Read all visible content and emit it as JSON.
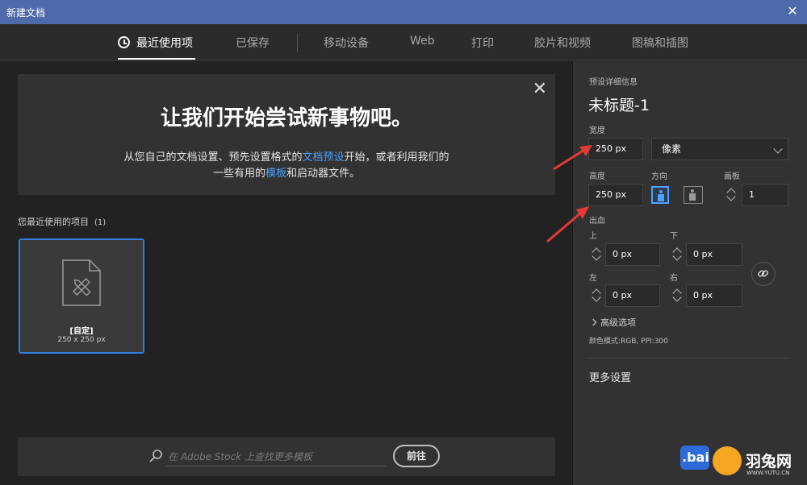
{
  "window": {
    "title": "新建文档",
    "close_label": "✕"
  },
  "tabs": [
    {
      "label": "最近使用项",
      "active": true
    },
    {
      "label": "已保存"
    },
    {
      "label": "移动设备"
    },
    {
      "label": "Web"
    },
    {
      "label": "打印"
    },
    {
      "label": "胶片和视频"
    },
    {
      "label": "图稿和插图"
    }
  ],
  "banner": {
    "close_label": "✕",
    "headline": "让我们开始尝试新事物吧。",
    "line1_before": "从您自己的文档设置、预先设置格式的",
    "line1_link": "文档预设",
    "line1_after": "开始，或者利用我们的",
    "line2_before": "一些有用的",
    "line2_link": "模板",
    "line2_after": "和启动器文件。"
  },
  "recent": {
    "label": "您最近使用的项目",
    "count": "(1)",
    "items": [
      {
        "name": "[自定]",
        "size": "250 x 250 px"
      }
    ]
  },
  "search": {
    "placeholder": "在 Adobe Stock 上查找更多模板",
    "go_label": "前往"
  },
  "preset": {
    "section_label": "预设详细信息",
    "doc_name": "未标题-1",
    "width_label": "宽度",
    "width_value": "250 px",
    "unit_value": "像素",
    "height_label": "高度",
    "height_value": "250 px",
    "orientation_label": "方向",
    "artboards_label": "画板",
    "artboards_value": "1",
    "bleed_label": "出血",
    "bleed_top_label": "上",
    "bleed_top_value": "0 px",
    "bleed_bottom_label": "下",
    "bleed_bottom_value": "0 px",
    "bleed_left_label": "左",
    "bleed_left_value": "0 px",
    "bleed_right_label": "右",
    "bleed_right_value": "0 px",
    "advanced_label": "高级选项",
    "color_mode": "颜色模式:RGB, PPI:300",
    "more_settings": "更多设置"
  },
  "watermark": {
    "text": "羽兔网",
    "url": "WWW.YUTU.CN",
    "bai": ".bai"
  },
  "colors": {
    "accent": "#2f7de1",
    "titlebar": "#4f6aaa",
    "link": "#4da0ff",
    "arrow": "#e53935"
  }
}
